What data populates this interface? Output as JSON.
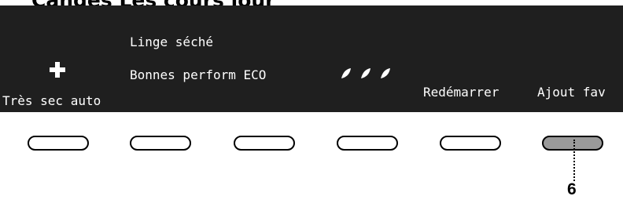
{
  "header_fragment": "Cangés   Les   cours   jour",
  "panel": {
    "line_top": "Linge séché",
    "line_mid": "Bonnes perform ECO",
    "btn1_label": "Très sec auto",
    "btn5_label": "Redémarrer",
    "btn6_label": "Ajout fav"
  },
  "buttons": [
    {
      "id": 1,
      "pressed": false
    },
    {
      "id": 2,
      "pressed": false
    },
    {
      "id": 3,
      "pressed": false
    },
    {
      "id": 4,
      "pressed": false
    },
    {
      "id": 5,
      "pressed": false
    },
    {
      "id": 6,
      "pressed": true
    }
  ],
  "callout_number": "6",
  "icons": {
    "plus": "plus-icon",
    "eco": "eco-leaf-icon"
  },
  "colors": {
    "panel_bg": "#1f1f1f",
    "panel_text": "#ffffff",
    "pressed_button": "#9a9a9a"
  }
}
